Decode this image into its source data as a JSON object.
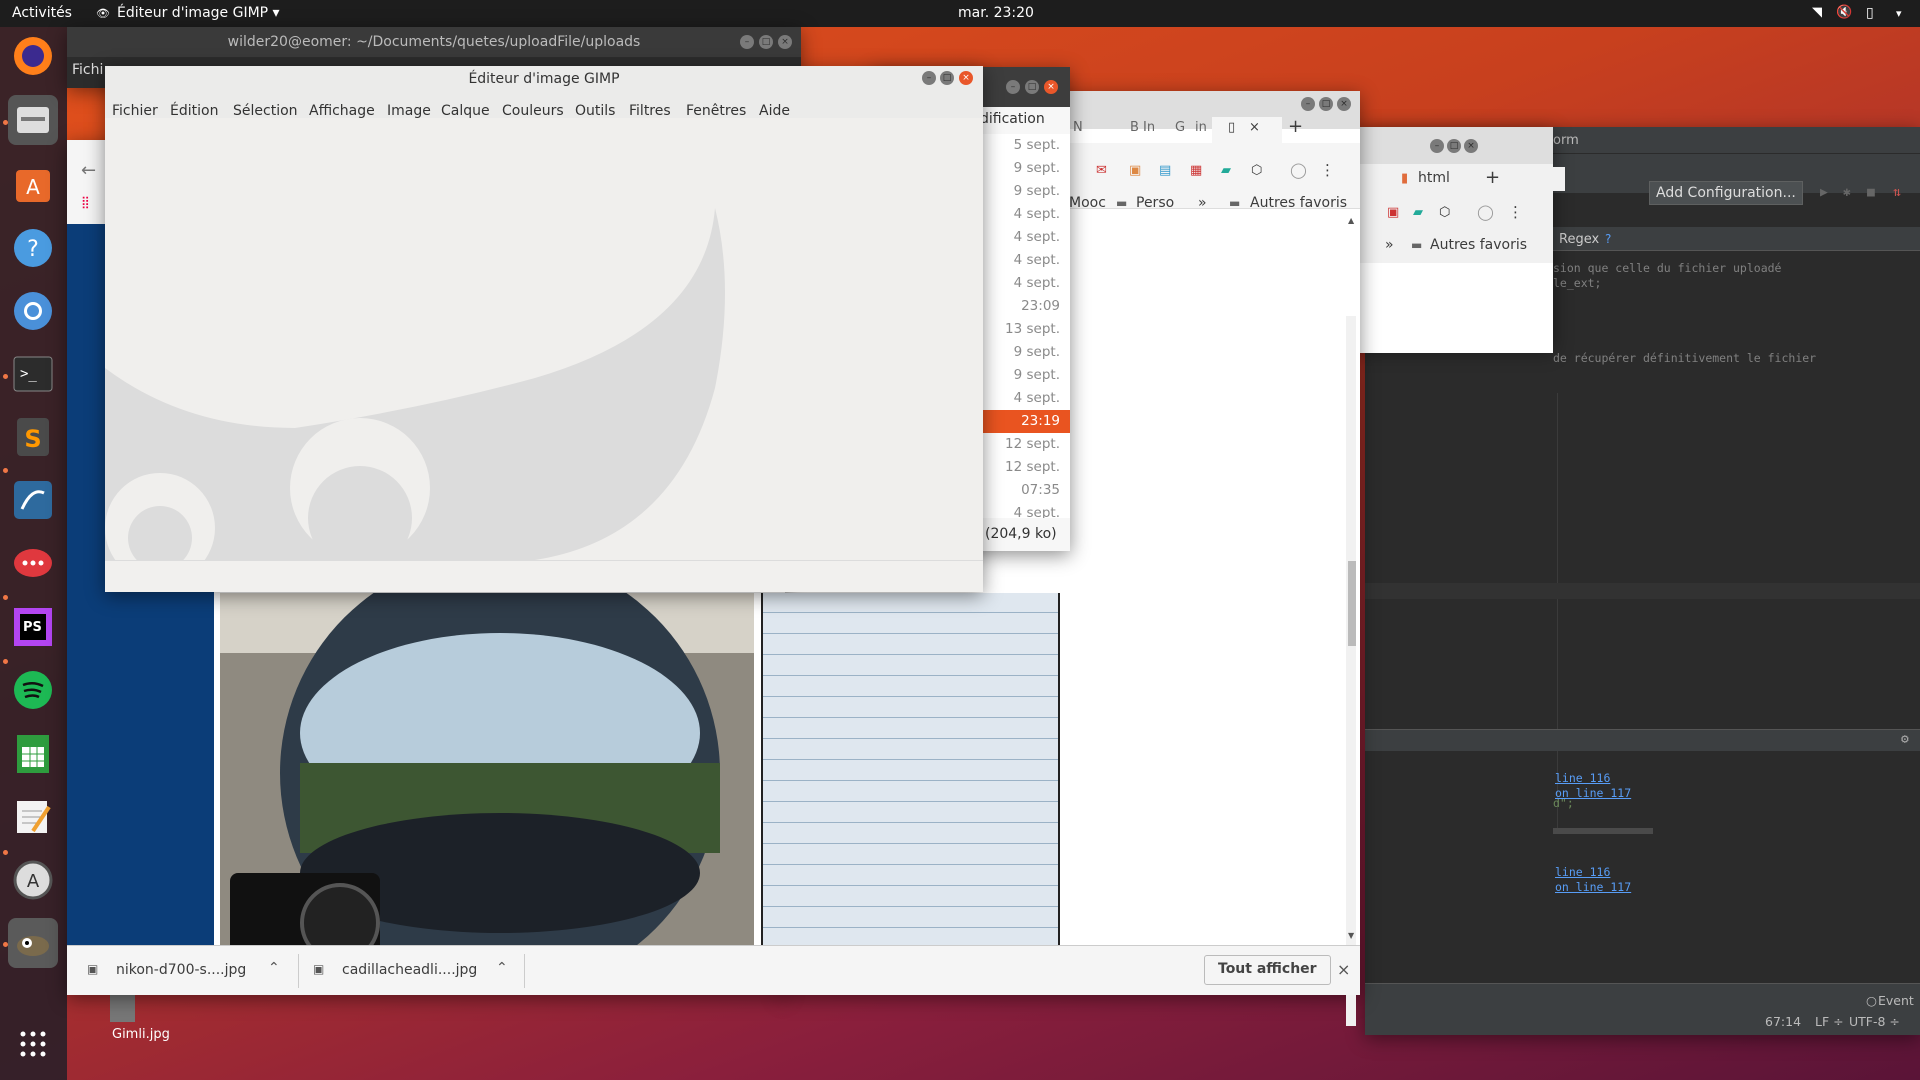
{
  "topbar": {
    "activities": "Activités",
    "app_menu": "Éditeur d'image GIMP ▾",
    "clock": "mar. 23:20"
  },
  "dock": {
    "items": [
      "firefox-icon",
      "files-icon",
      "software-center-icon",
      "help-icon",
      "chromium-icon",
      "terminal-icon",
      "sublime-text-icon",
      "mysql-workbench-icon",
      "rocket-chat-icon",
      "phpstorm-icon",
      "spotify-icon",
      "spreadsheet-icon",
      "text-editor-icon",
      "software-updater-icon",
      "gimp-icon",
      "show-apps-icon"
    ]
  },
  "terminal": {
    "title": "wilder20@eomer: ~/Documents/quetes/uploadFile/uploads",
    "menu_fragment": "Fichi"
  },
  "gimp": {
    "title": "Éditeur d'image GIMP",
    "menu": [
      "Fichier",
      "Édition",
      "Sélection",
      "Affichage",
      "Image",
      "Calque",
      "Couleurs",
      "Outils",
      "Filtres",
      "Fenêtres",
      "Aide"
    ]
  },
  "files": {
    "column_header": "dification",
    "dates": [
      "5 sept.",
      "9 sept.",
      "9 sept.",
      "4 sept.",
      "4 sept.",
      "4 sept.",
      "4 sept.",
      "23:09",
      "13 sept.",
      "9 sept.",
      "9 sept.",
      "4 sept.",
      "23:19",
      "12 sept.",
      "12 sept.",
      "07:35",
      "4 sept."
    ],
    "selected_index": 12,
    "status": "(204,9 ko)"
  },
  "chrome1": {
    "tabs": [
      "N",
      "B In",
      "in"
    ],
    "bookmarks": [
      "Mooc",
      "Perso",
      "»",
      "Autres favoris"
    ]
  },
  "chrome2": {
    "tab": "html",
    "bookmarks": [
      "»",
      "Autres favoris"
    ],
    "downloads": [
      {
        "name": "nikon-d700-s....jpg"
      },
      {
        "name": "cadillacheadli....jpg"
      }
    ],
    "show_all": "Tout afficher"
  },
  "ide": {
    "title_fragment": "orm",
    "config_button": "Add Configuration...",
    "regex": "Regex",
    "regex_help": "?",
    "code": [
      "sion que celle du fichier uploadé",
      "le_ext;",
      "",
      "",
      "",
      "",
      "de récupérer définitivement le fichier"
    ],
    "code2": "d\";",
    "links": [
      "line 116",
      "on line 117",
      "line 116",
      "on line 117"
    ],
    "event_log": "Event",
    "status": {
      "position": "67:14",
      "line_sep": "LF ÷",
      "encoding": "UTF-8 ÷"
    }
  },
  "desktop": {
    "file_label": "Gimli.jpg"
  },
  "colors": {
    "accent": "#e95420",
    "topbar": "#1d1d1d",
    "ide_bg": "#2b2b2b"
  }
}
